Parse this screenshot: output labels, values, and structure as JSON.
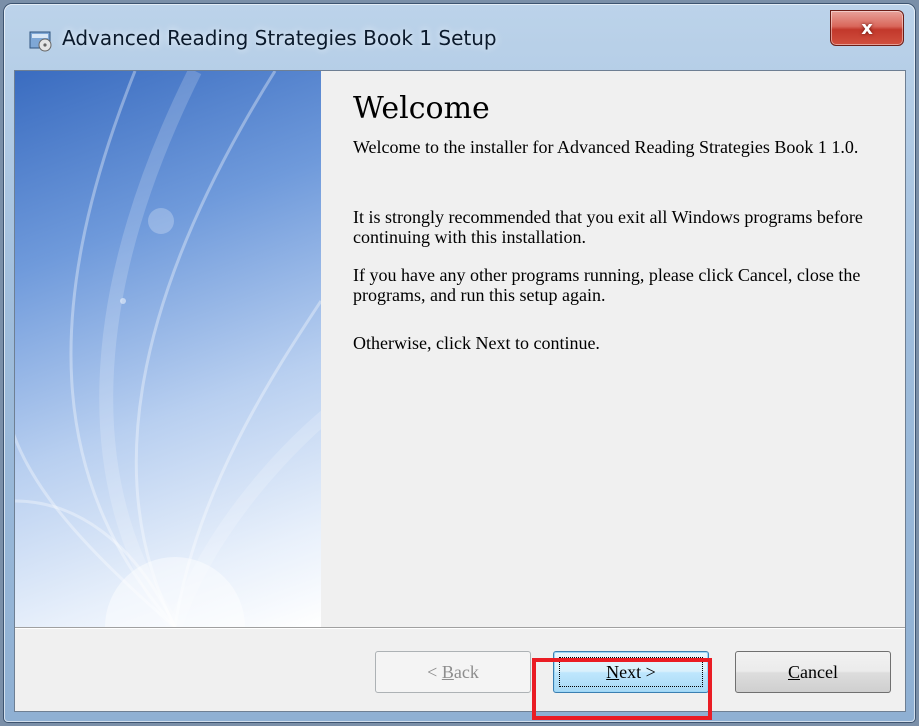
{
  "window": {
    "title": "Advanced Reading Strategies Book 1 Setup",
    "close_label": "x"
  },
  "content": {
    "heading": "Welcome",
    "paragraphs": [
      "Welcome to the installer for Advanced Reading Strategies Book 1 1.0.",
      "It is strongly recommended that you exit all Windows programs before continuing with this installation.",
      "If you have any other programs running, please click Cancel, close the programs, and run this setup again.",
      "Otherwise, click Next to continue."
    ]
  },
  "buttons": {
    "back": {
      "prefix": "< ",
      "mnemonic": "B",
      "rest": "ack"
    },
    "next": {
      "mnemonic": "N",
      "rest": "ext >"
    },
    "cancel": {
      "mnemonic": "C",
      "rest": "ancel"
    }
  },
  "icons": {
    "app": "installer-icon",
    "close": "close-icon"
  },
  "colors": {
    "highlight": "#ea1c24",
    "close_button": "#c2382b"
  }
}
